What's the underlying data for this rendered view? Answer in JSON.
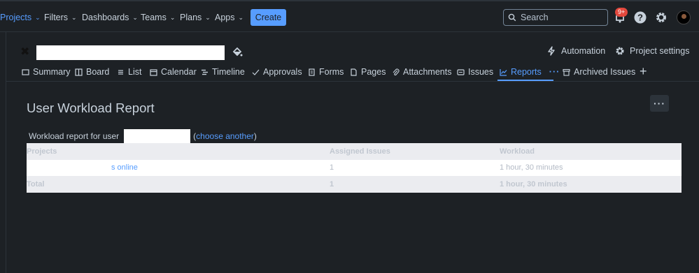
{
  "topnav": {
    "items": [
      {
        "label": "Projects",
        "active": true
      },
      {
        "label": "Filters"
      },
      {
        "label": "Dashboards"
      },
      {
        "label": "Teams"
      },
      {
        "label": "Plans"
      },
      {
        "label": "Apps"
      }
    ],
    "create_label": "Create",
    "search_placeholder": "Search",
    "notifications_badge": "9+"
  },
  "project": {
    "automation_label": "Automation",
    "settings_label": "Project settings"
  },
  "tabs": [
    {
      "label": "Summary",
      "icon": "summary-icon"
    },
    {
      "label": "Board",
      "icon": "board-icon"
    },
    {
      "label": "List",
      "icon": "list-icon"
    },
    {
      "label": "Calendar",
      "icon": "calendar-icon"
    },
    {
      "label": "Timeline",
      "icon": "timeline-icon"
    },
    {
      "label": "Approvals",
      "icon": "approvals-icon"
    },
    {
      "label": "Forms",
      "icon": "forms-icon"
    },
    {
      "label": "Pages",
      "icon": "pages-icon"
    },
    {
      "label": "Attachments",
      "icon": "attachment-icon"
    },
    {
      "label": "Issues",
      "icon": "issues-icon"
    },
    {
      "label": "Reports",
      "icon": "reports-icon",
      "active": true
    },
    {
      "label": "Archived Issues",
      "icon": "archive-icon"
    }
  ],
  "report": {
    "title": "User Workload Report",
    "for_user_text": "Workload report for user",
    "choose_another": "choose another",
    "paren_open": "(",
    "paren_close": ")",
    "columns": [
      "Projects",
      "Assigned Issues",
      "Workload"
    ],
    "rows": [
      {
        "project": "s online",
        "assigned": "1",
        "workload": "1 hour, 30 minutes"
      }
    ],
    "total": {
      "label": "Total",
      "assigned": "1",
      "workload": "1 hour, 30 minutes"
    }
  },
  "colors": {
    "background": "#1d2125",
    "accent": "#579dff",
    "badge": "#e2483d"
  }
}
